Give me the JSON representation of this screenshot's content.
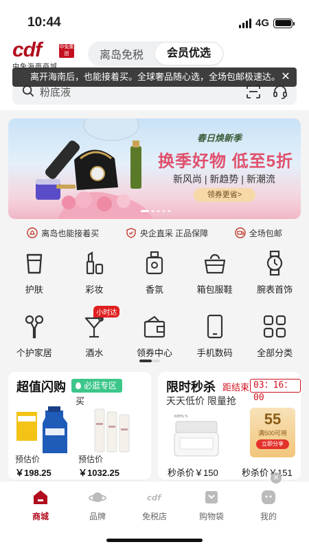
{
  "status_bar": {
    "time": "10:44",
    "network": "4G"
  },
  "header": {
    "logo_text": "cdf",
    "logo_badge": "中免集团",
    "logo_sub": "中免海南商城",
    "segments": [
      {
        "label": "离岛免税",
        "active": false
      },
      {
        "label": "会员优选",
        "active": true
      }
    ]
  },
  "toast": {
    "text": "离开海南后，也能接着买。全球奢品随心选，全场包邮极速达。",
    "close": "✕"
  },
  "search": {
    "placeholder": "粉底液"
  },
  "banner": {
    "tag": "春日焕新季",
    "title": "换季好物 低至5折",
    "subtitle": "新风尚 | 新趋势 | 新潮流",
    "button": "领券更省>"
  },
  "guarantees": [
    {
      "label": "离岛也能接着买",
      "icon": "island-icon"
    },
    {
      "label": "央企直采 正品保障",
      "icon": "shield-icon"
    },
    {
      "label": "全场包邮",
      "icon": "shipping-icon"
    }
  ],
  "categories": [
    {
      "label": "护肤",
      "icon": "skincare-icon"
    },
    {
      "label": "彩妆",
      "icon": "makeup-icon"
    },
    {
      "label": "香氛",
      "icon": "perfume-icon"
    },
    {
      "label": "箱包服鞋",
      "icon": "bag-icon"
    },
    {
      "label": "腕表首饰",
      "icon": "watch-icon"
    },
    {
      "label": "个护家居",
      "icon": "personal-care-icon"
    },
    {
      "label": "酒水",
      "icon": "wine-icon",
      "badge": "小时达"
    },
    {
      "label": "领券中心",
      "icon": "coupon-wallet-icon"
    },
    {
      "label": "手机数码",
      "icon": "phone-icon"
    },
    {
      "label": "全部分类",
      "icon": "grid-icon"
    }
  ],
  "flash_deals": {
    "title": "超值闪购",
    "tag": "必逛专区",
    "marquee": "买",
    "items": [
      {
        "price_label": "预估价",
        "price": "￥198.25"
      },
      {
        "price_label": "预估价",
        "price": "￥1032.25"
      }
    ]
  },
  "seckill": {
    "title": "限时秒杀",
    "countdown_label": "距结束",
    "countdown": "03：16：00",
    "subtitle": "天天低价 限量抢",
    "items": [
      {
        "price": "秒杀价￥150"
      },
      {
        "price": "秒杀价￥151"
      }
    ],
    "coupon": {
      "amount": "55",
      "condition": "满500可用",
      "button": "立即分享"
    }
  },
  "tabbar": [
    {
      "label": "商城",
      "icon": "home-icon",
      "active": true
    },
    {
      "label": "品牌",
      "icon": "planet-icon",
      "active": false
    },
    {
      "label": "免税店",
      "icon": "cdf-logo-icon",
      "active": false
    },
    {
      "label": "购物袋",
      "icon": "shopping-bag-icon",
      "active": false
    },
    {
      "label": "我的",
      "icon": "profile-icon",
      "active": false
    }
  ],
  "colors": {
    "brand": "#b10d1e",
    "accent_red": "#d0101e",
    "tag_green": "#3cc68a",
    "banner_pink": "#e0506d"
  }
}
